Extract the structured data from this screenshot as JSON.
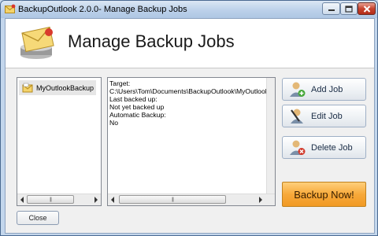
{
  "window": {
    "title": "BackupOutlook 2.0.0- Manage Backup Jobs",
    "controls": {
      "minimize_icon": "minimize-icon",
      "maximize_icon": "maximize-icon",
      "close_icon": "close-icon"
    }
  },
  "header": {
    "title": "Manage Backup Jobs",
    "icon": "envelope-drive-icon"
  },
  "jobs_list": {
    "items": [
      {
        "label": "MyOutlookBackup",
        "icon": "outlook-job-icon",
        "selected": true
      }
    ]
  },
  "details": {
    "lines": [
      "Target:",
      "C:\\Users\\Tom\\Documents\\BackupOutlook\\MyOutlookBackup",
      "Last backed up:",
      "Not yet backed up",
      "Automatic Backup:",
      "No"
    ]
  },
  "actions": {
    "add_label": "Add Job",
    "edit_label": "Edit Job",
    "delete_label": "Delete Job",
    "backup_label": "Backup Now!",
    "close_label": "Close"
  },
  "scrollbars": {
    "grip": "|||"
  },
  "colors": {
    "backup_button": "#f7a93a",
    "titlebar": "#bcd1ea",
    "close_button": "#c7442f"
  }
}
